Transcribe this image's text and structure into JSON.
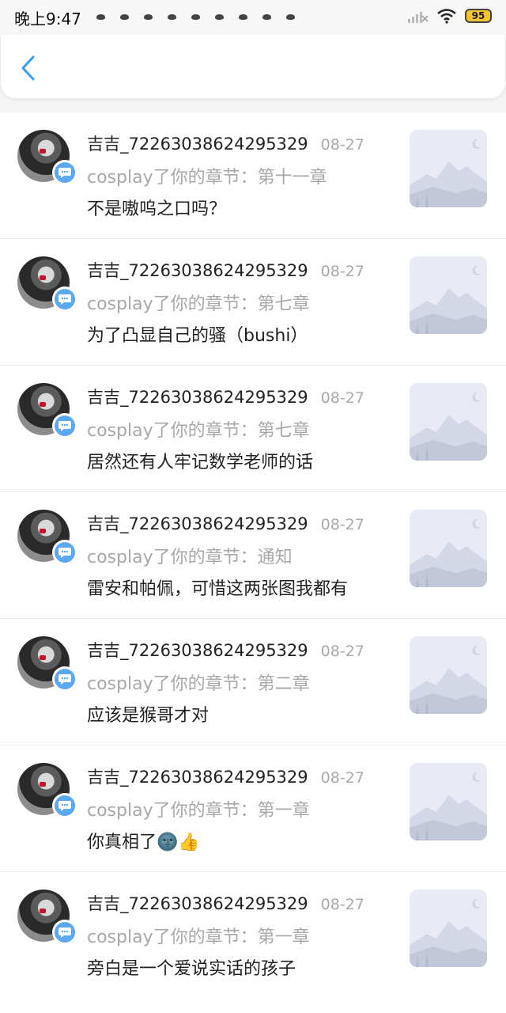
{
  "status_bar": {
    "time": "晚上9:47",
    "battery": "95",
    "notification_icon_count": 9
  },
  "header": {
    "back_icon": "chevron-left-icon",
    "accent_color": "#3a9df0"
  },
  "items": [
    {
      "user": "吉吉_72263038624295329",
      "date": "08-27",
      "chapter": "cosplay了你的章节：第十一章",
      "comment": "不是嗷呜之口吗？"
    },
    {
      "user": "吉吉_72263038624295329",
      "date": "08-27",
      "chapter": "cosplay了你的章节：第七章",
      "comment": "为了凸显自己的骚（bushi）"
    },
    {
      "user": "吉吉_72263038624295329",
      "date": "08-27",
      "chapter": "cosplay了你的章节：第七章",
      "comment": "居然还有人牢记数学老师的话"
    },
    {
      "user": "吉吉_72263038624295329",
      "date": "08-27",
      "chapter": "cosplay了你的章节：通知",
      "comment": "雷安和帕佩，可惜这两张图我都有"
    },
    {
      "user": "吉吉_72263038624295329",
      "date": "08-27",
      "chapter": "cosplay了你的章节：第二章",
      "comment": "应该是猴哥才对"
    },
    {
      "user": "吉吉_72263038624295329",
      "date": "08-27",
      "chapter": "cosplay了你的章节：第一章",
      "comment": "你真相了🌚👍"
    },
    {
      "user": "吉吉_72263038624295329",
      "date": "08-27",
      "chapter": "cosplay了你的章节：第一章",
      "comment": "旁白是一个爱说实话的孩子"
    }
  ]
}
